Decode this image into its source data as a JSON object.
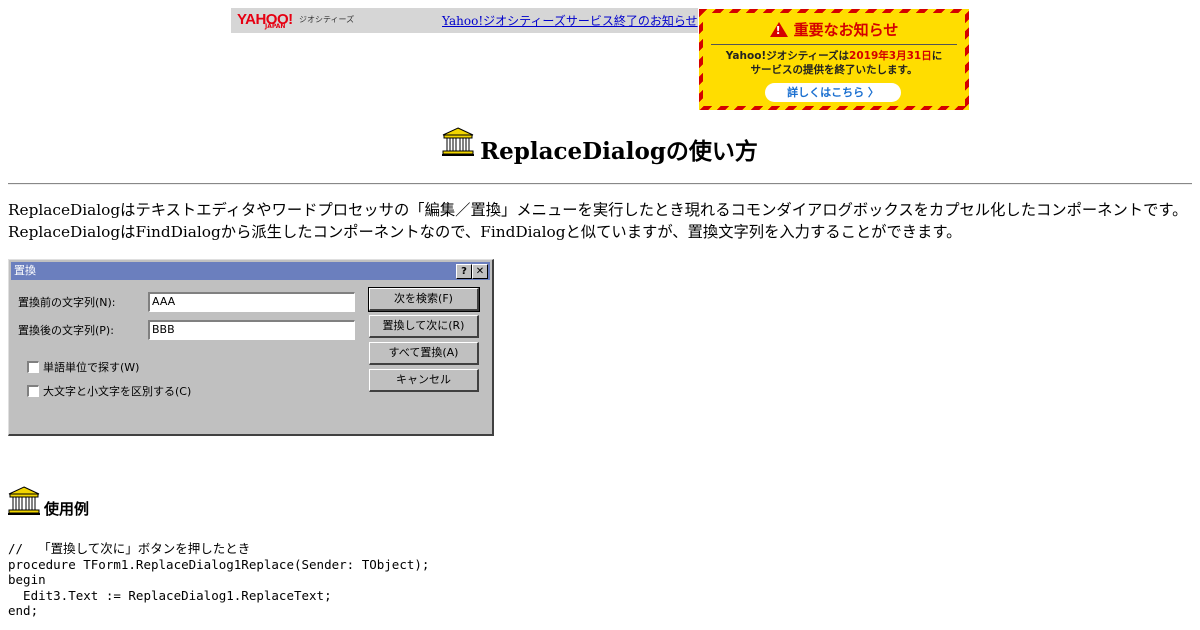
{
  "yahoo_bar": {
    "logo": "YAHOO!",
    "logo_sub": "JAPAN",
    "logo_service": "ジオシティーズ",
    "link": "Yahoo!ジオシティーズサービス終了のお知らせ"
  },
  "notice": {
    "title": "重要なお知らせ",
    "line1_a": "Yahoo!ジオシティーズは",
    "line1_date": "2019年3月31日",
    "line1_b": "に",
    "line2": "サービスの提供を終了いたします。",
    "button": "詳しくはこちら 〉"
  },
  "page": {
    "title": "ReplaceDialogの使い方",
    "intro": "ReplaceDialogはテキストエディタやワードプロセッサの「編集／置換」メニューを実行したとき現れるコモンダイアログボックスをカプセル化したコンポーネントです。ReplaceDialogはFindDialogから派生したコンポーネントなので、FindDialogと似ていますが、置換文字列を入力することができます。",
    "section_title": "使用例",
    "code": "//  「置換して次に」ボタンを押したとき\nprocedure TForm1.ReplaceDialog1Replace(Sender: TObject);\nbegin\n  Edit3.Text := ReplaceDialog1.ReplaceText;\nend;"
  },
  "dialog": {
    "title": "置換",
    "help": "?",
    "close": "✕",
    "find_label": "置換前の文字列(N):",
    "find_value": "AAA",
    "replace_label": "置換後の文字列(P):",
    "replace_value": "BBB",
    "whole_word": "単語単位で探す(W)",
    "match_case": "大文字と小文字を区別する(C)",
    "btn_find_next": "次を検索(F)",
    "btn_replace": "置換して次に(R)",
    "btn_replace_all": "すべて置換(A)",
    "btn_cancel": "キャンセル"
  },
  "colors": {
    "titlebar": "#6b7fbe",
    "dialog_face": "#c0c0c0",
    "notice_red": "#d40000",
    "notice_yellow": "#ffdd00",
    "link": "#0000cc"
  },
  "icons": [
    "temple-icon",
    "warning-icon"
  ]
}
